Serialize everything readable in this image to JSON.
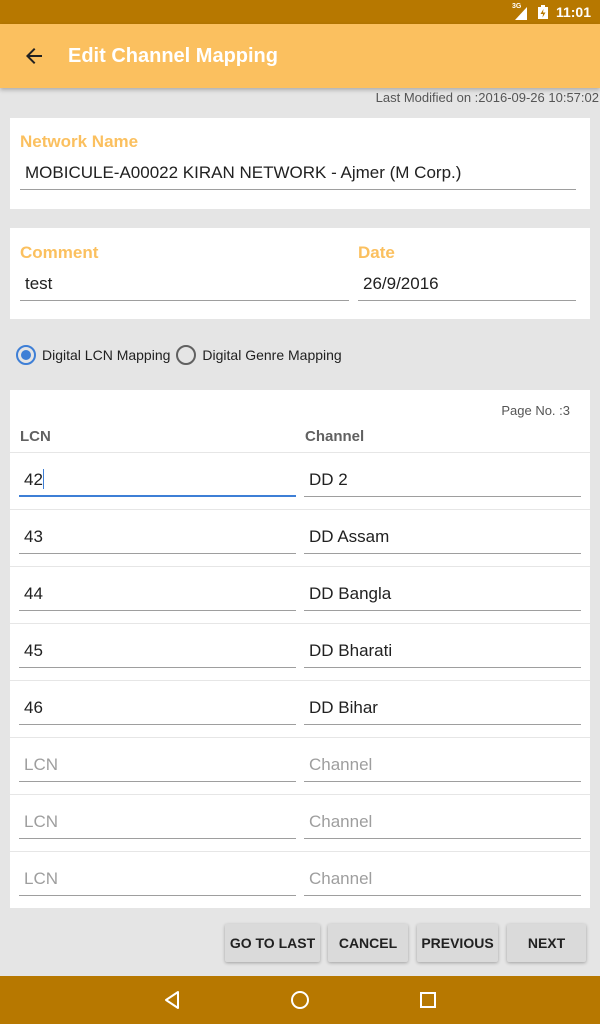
{
  "status_bar": {
    "network_type": "3G",
    "time": "11:01"
  },
  "app_bar": {
    "title": "Edit Channel Mapping",
    "back_icon": "arrow-back-icon"
  },
  "last_modified": "Last Modified on :2016-09-26 10:57:02",
  "network": {
    "label": "Network Name",
    "value": "MOBICULE-A00022 KIRAN NETWORK - Ajmer (M Corp.)",
    "spellcheck_word": "KIRAN"
  },
  "comment": {
    "label": "Comment",
    "value": "test"
  },
  "date": {
    "label": "Date",
    "value": "26/9/2016"
  },
  "mapping_type": {
    "options": [
      {
        "label": "Digital LCN Mapping",
        "checked": true
      },
      {
        "label": "Digital Genre Mapping",
        "checked": false
      }
    ]
  },
  "table": {
    "page_no": "Page No. :3",
    "headers": {
      "lcn": "LCN",
      "channel": "Channel"
    },
    "placeholders": {
      "lcn": "LCN",
      "channel": "Channel"
    },
    "rows": [
      {
        "lcn": "42",
        "channel": "DD 2"
      },
      {
        "lcn": "43",
        "channel": "DD Assam"
      },
      {
        "lcn": "44",
        "channel": "DD Bangla"
      },
      {
        "lcn": "45",
        "channel": "DD Bharati"
      },
      {
        "lcn": "46",
        "channel": "DD Bihar"
      },
      {
        "lcn": "",
        "channel": ""
      },
      {
        "lcn": "",
        "channel": ""
      },
      {
        "lcn": "",
        "channel": ""
      }
    ]
  },
  "buttons": {
    "go_to_last": "GO TO LAST",
    "cancel": "CANCEL",
    "previous": "PREVIOUS",
    "next": "NEXT"
  },
  "colors": {
    "status_bar": "#b77800",
    "app_bar": "#fbc05f",
    "accent": "#3e7fd6",
    "label": "#fbc05f"
  }
}
